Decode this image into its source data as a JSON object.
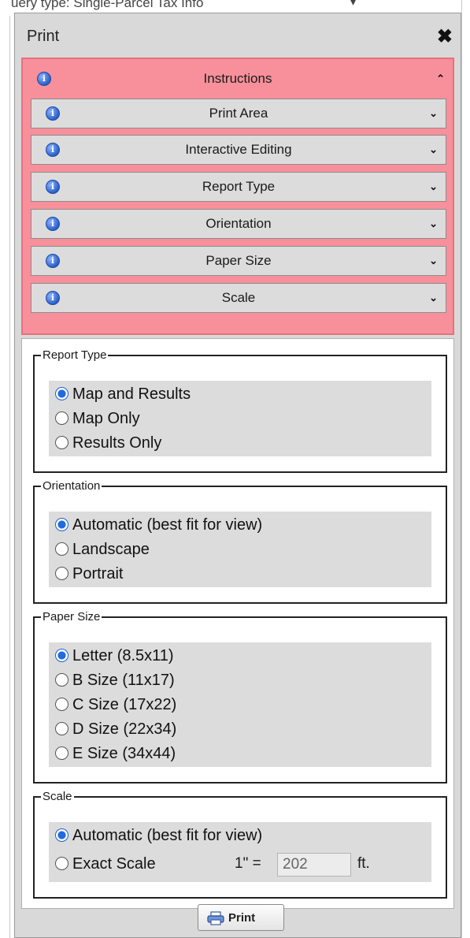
{
  "background": {
    "query_text": "uery type: Single-Parcel Tax Info"
  },
  "dialog": {
    "title": "Print",
    "close_glyph": "✖",
    "close_icon": "close-icon"
  },
  "accordion": {
    "header": {
      "label": "Instructions",
      "icon": "info-icon",
      "chevron": "chevron-up-icon",
      "chevron_glyph": "⌃"
    },
    "sections": [
      {
        "label": "Print Area",
        "icon": "info-icon",
        "chevron": "chevron-down-icon"
      },
      {
        "label": "Interactive Editing",
        "icon": "info-icon",
        "chevron": "chevron-down-icon"
      },
      {
        "label": "Report Type",
        "icon": "info-icon",
        "chevron": "chevron-down-icon"
      },
      {
        "label": "Orientation",
        "icon": "info-icon",
        "chevron": "chevron-down-icon"
      },
      {
        "label": "Paper Size",
        "icon": "info-icon",
        "chevron": "chevron-down-icon"
      },
      {
        "label": "Scale",
        "icon": "info-icon",
        "chevron": "chevron-down-icon"
      }
    ],
    "chevron_glyph": "⌄",
    "info_glyph": "i",
    "highlight_color": "#f7909b"
  },
  "report_type": {
    "legend": "Report Type",
    "options": [
      "Map and Results",
      "Map Only",
      "Results Only"
    ],
    "selected": "Map and Results"
  },
  "orientation": {
    "legend": "Orientation",
    "options": [
      "Automatic (best fit for view)",
      "Landscape",
      "Portrait"
    ],
    "selected": "Automatic (best fit for view)"
  },
  "paper_size": {
    "legend": "Paper Size",
    "options": [
      "Letter (8.5x11)",
      "B Size (11x17)",
      "C Size (17x22)",
      "D Size (22x34)",
      "E Size (34x44)"
    ],
    "selected": "Letter (8.5x11)"
  },
  "scale": {
    "legend": "Scale",
    "options": [
      "Automatic (best fit for view)",
      "Exact Scale"
    ],
    "selected": "Automatic (best fit for view)",
    "exact_prefix": "1\" =",
    "exact_value": "202",
    "exact_unit": "ft."
  },
  "footer": {
    "print_label": "Print",
    "print_icon": "printer-icon"
  }
}
